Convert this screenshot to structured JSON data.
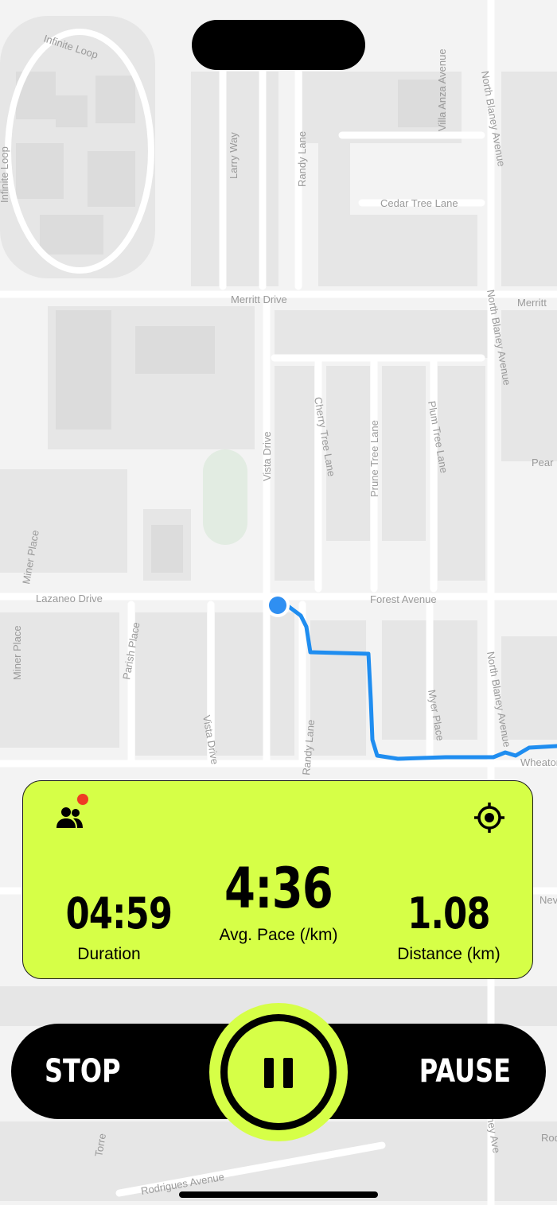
{
  "map": {
    "streets": [
      "Infinite Loop",
      "Infinite Loop",
      "Larry Way",
      "Randy Lane",
      "Villa Anza Avenue",
      "North Blaney Avenue",
      "Cedar Tree Lane",
      "Merritt Drive",
      "Merritt",
      "North Blaney Avenue",
      "Vista Drive",
      "Cherry Tree Lane",
      "Prune Tree Lane",
      "Plum Tree Lane",
      "Pear",
      "Miner Place",
      "Miner Place",
      "Lazaneo Drive",
      "Forest Avenue",
      "Parish Place",
      "North Blaney Avenue",
      "Myer Place",
      "Wheaton",
      "Vista Drive",
      "Randy Lane",
      "Rodrigues Avenue",
      "Torre",
      "Rodrig",
      "ney Ave",
      "Nev"
    ],
    "route_color": "#1f8df0",
    "location_color": "#2f8ff2"
  },
  "stats": {
    "duration": {
      "value": "04:59",
      "label": "Duration"
    },
    "pace": {
      "value": "4:36",
      "label": "Avg. Pace (/km)"
    },
    "distance": {
      "value": "1.08",
      "label": "Distance (km)"
    },
    "friends_icon": "group-icon",
    "notification_color": "#ef3b24",
    "locate_icon": "crosshair-icon"
  },
  "controls": {
    "stop_label": "STOP",
    "pause_label": "PAUSE",
    "center_icon": "pause-icon",
    "accent": "#d6ff47"
  }
}
